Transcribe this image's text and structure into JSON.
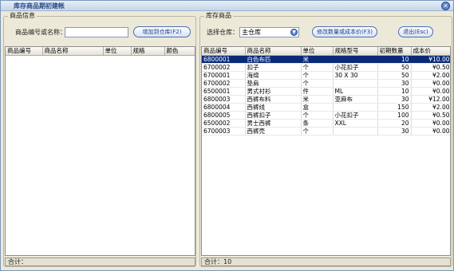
{
  "window": {
    "title": "库存商品期初建帐",
    "close_glyph": "✕"
  },
  "left_panel": {
    "group_title": "商品信息",
    "search_label": "商品编号或名称：",
    "search_value": "",
    "add_button": "增加到仓库(F2)",
    "columns": [
      "商品编号",
      "商品名称",
      "单位",
      "规格",
      "颜色"
    ],
    "status_label": "合计："
  },
  "right_panel": {
    "group_title": "库存商品",
    "warehouse_label": "选择仓库：",
    "warehouse_value": "主仓库",
    "edit_button": "修改数量或成本价(F3)",
    "exit_button": "退出(Esc)",
    "columns": [
      "商品编号",
      "商品名称",
      "单位",
      "规格型号",
      "初期数量",
      "成本价"
    ],
    "rows": [
      [
        "6800001",
        "白色布匹",
        "米",
        "",
        "10",
        "¥10.00"
      ],
      [
        "6700002",
        "扣子",
        "个",
        "小花扣子",
        "50",
        "¥0.50"
      ],
      [
        "6700001",
        "海绵",
        "个",
        "30 X 30",
        "50",
        "¥2.00"
      ],
      [
        "6700002",
        "垫肩",
        "个",
        "",
        "30",
        "¥0.00"
      ],
      [
        "6500001",
        "男式衬衫",
        "件",
        "ML",
        "10",
        "¥0.00"
      ],
      [
        "6800003",
        "西裤布料",
        "米",
        "亚麻布",
        "30",
        "¥12.00"
      ],
      [
        "6800004",
        "西裤线",
        "盒",
        "",
        "150",
        "¥2.00"
      ],
      [
        "6800005",
        "西裤扣子",
        "个",
        "小花扣子",
        "100",
        "¥0.50"
      ],
      [
        "6500002",
        "男士西裤",
        "条",
        "XXL",
        "20",
        "¥0.00"
      ],
      [
        "6700003",
        "西裤壳",
        "个",
        "",
        "30",
        "¥0.00"
      ]
    ],
    "selected_row": 0,
    "status_label": "合计：10"
  }
}
